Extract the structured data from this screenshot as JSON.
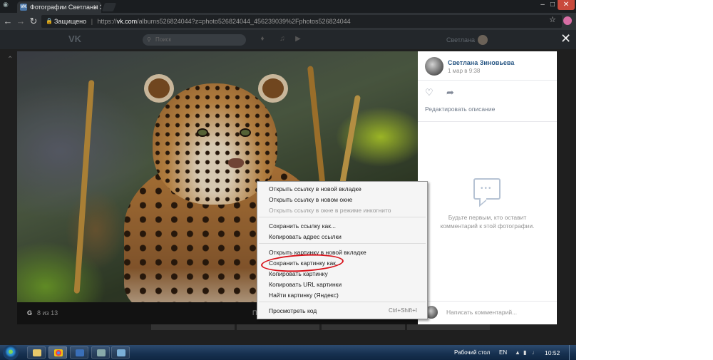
{
  "browser": {
    "tab_title": "Фотографии Светланы З",
    "omnibox": {
      "secure_label": "Защищено",
      "separator": "|",
      "scheme": "https://",
      "host": "vk.com",
      "path": "/albums526824044?z=photo526824044_456239039%2Fphotos526824044"
    }
  },
  "vk_header": {
    "logo": "VK",
    "search_placeholder": "Поиск",
    "user_name": "Светлана"
  },
  "photo_viewer": {
    "watermark": "G",
    "counter": "8 из 13",
    "footer_link": "П",
    "author": "Светлана Зиновьева",
    "date": "1 мар в 9:38",
    "edit_description": "Редактировать описание",
    "empty_comments": "Будьте первым, кто оставит комментарий к этой фотографии.",
    "comment_placeholder": "Написать комментарий..."
  },
  "context_menu": {
    "items": [
      {
        "label": "Открыть ссылку в новой вкладке",
        "enabled": true
      },
      {
        "label": "Открыть ссылку в новом окне",
        "enabled": true
      },
      {
        "label": "Открыть ссылку в окне в режиме инкогнито",
        "enabled": false
      },
      {
        "label": "Сохранить ссылку как...",
        "enabled": true
      },
      {
        "label": "Копировать адрес ссылки",
        "enabled": true
      },
      {
        "label": "Открыть картинку в новой вкладке",
        "enabled": true
      },
      {
        "label": "Сохранить картинку как...",
        "enabled": true,
        "highlighted": true
      },
      {
        "label": "Копировать картинку",
        "enabled": true
      },
      {
        "label": "Копировать URL картинки",
        "enabled": true
      },
      {
        "label": "Найти картинку (Яндекс)",
        "enabled": true
      },
      {
        "label": "Просмотреть код",
        "enabled": true,
        "shortcut": "Ctrl+Shift+I"
      }
    ]
  },
  "taskbar": {
    "desktop_label": "Рабочий стол",
    "language": "EN",
    "clock": "10:52"
  },
  "colors": {
    "vk_blue": "#2a5885",
    "highlight_ring": "#d8121a",
    "chrome_dark": "#2f3337"
  }
}
